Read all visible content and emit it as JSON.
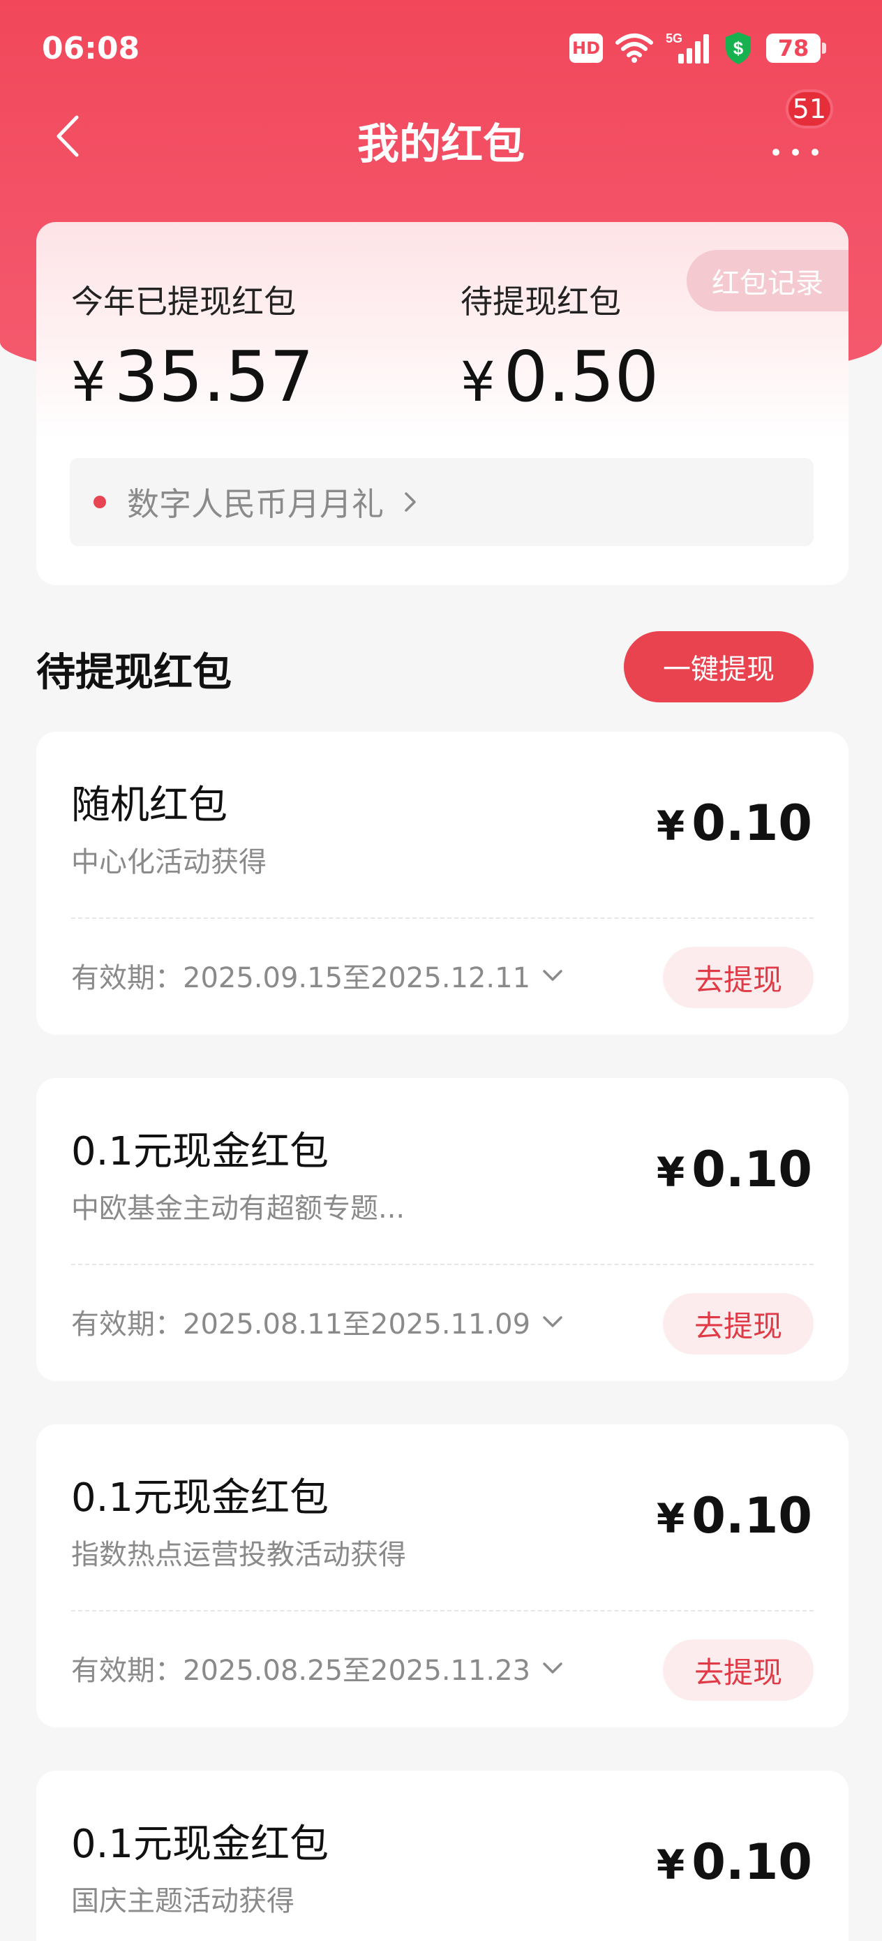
{
  "status_bar": {
    "time": "06:08",
    "hd": "HD",
    "network": "5G",
    "battery": "78"
  },
  "nav": {
    "title": "我的红包",
    "more_badge": "51"
  },
  "summary": {
    "history_button": "红包记录",
    "withdrawn_label": "今年已提现红包",
    "withdrawn_currency": "¥",
    "withdrawn_value": "35.57",
    "pending_label": "待提现红包",
    "pending_currency": "¥",
    "pending_value": "0.50",
    "promo_text": "数字人民币月月礼"
  },
  "section": {
    "title": "待提现红包",
    "withdraw_all": "一键提现"
  },
  "envelopes": [
    {
      "title": "随机红包",
      "subtitle": "中心化活动获得",
      "currency": "¥",
      "amount": "0.10",
      "validity": "有效期：2025.09.15至2025.12.11",
      "button": "去提现"
    },
    {
      "title": "0.1元现金红包",
      "subtitle": "中欧基金主动有超额专题...",
      "currency": "¥",
      "amount": "0.10",
      "validity": "有效期：2025.08.11至2025.11.09",
      "button": "去提现"
    },
    {
      "title": "0.1元现金红包",
      "subtitle": "指数热点运营投教活动获得",
      "currency": "¥",
      "amount": "0.10",
      "validity": "有效期：2025.08.25至2025.11.23",
      "button": "去提现"
    },
    {
      "title": "0.1元现金红包",
      "subtitle": "国庆主题活动获得",
      "currency": "¥",
      "amount": "0.10"
    }
  ],
  "colors": {
    "brand_red": "#f2475a",
    "button_red": "#e8434f",
    "promo_dot": "#e84552"
  },
  "icons": [
    "back-icon",
    "more-icon",
    "wifi-icon",
    "signal-icon",
    "shield-icon",
    "chevron-right-icon",
    "chevron-down-icon"
  ]
}
